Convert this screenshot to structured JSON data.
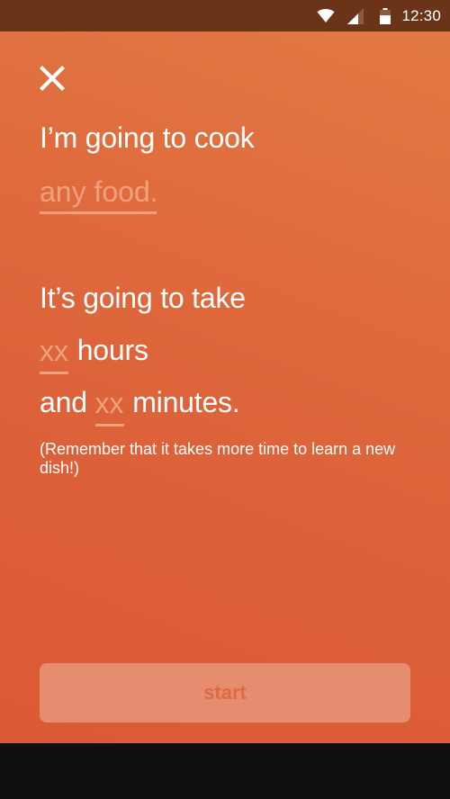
{
  "status_bar": {
    "time": "12:30",
    "icons": [
      "wifi-icon",
      "signal-icon",
      "battery-icon"
    ]
  },
  "header": {
    "close_icon": "close-icon"
  },
  "cook": {
    "prefix": "I’m going to cook",
    "food_placeholder": "any food.",
    "food_value": ""
  },
  "duration": {
    "intro": "It’s going to take",
    "hours_placeholder": "xx",
    "hours_value": "",
    "hours_label": "hours",
    "and_label": "and",
    "minutes_placeholder": "xx",
    "minutes_value": "",
    "minutes_label": "minutes."
  },
  "note": "(Remember that it takes more time to learn a new dish!)",
  "start_button": {
    "label": "start"
  },
  "colors": {
    "accent": "#df6a3d",
    "status_bar": "#6b3418",
    "placeholder": "#f0a17c",
    "button_bg": "#e58d6e",
    "button_text": "#dd6a45"
  }
}
